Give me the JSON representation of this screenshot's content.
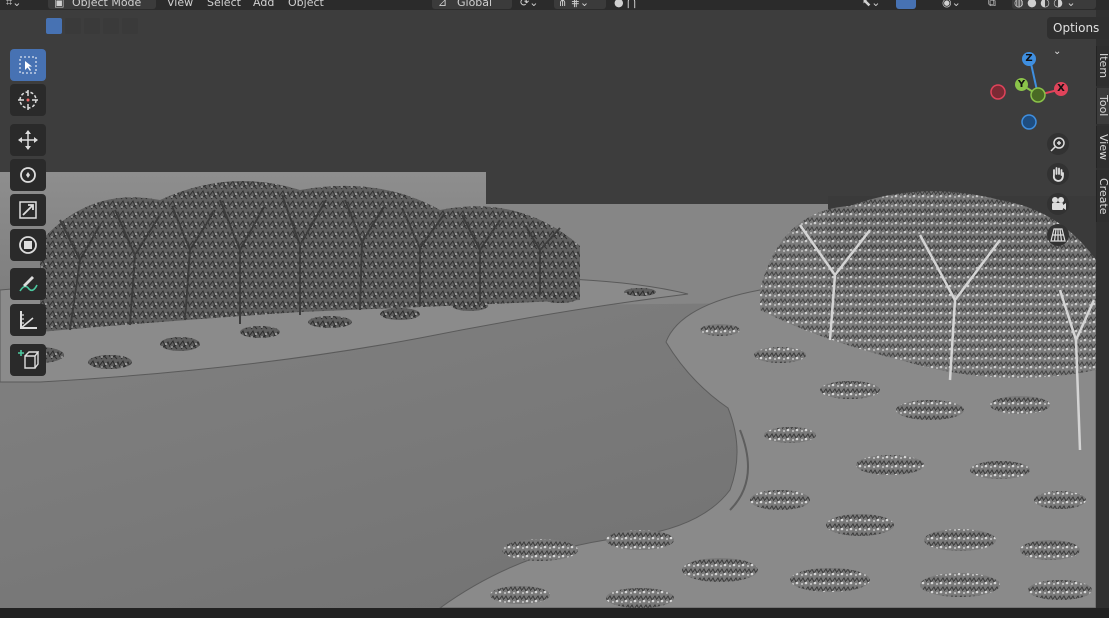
{
  "header": {
    "mode_label": "Object Mode",
    "menus": [
      "View",
      "Select",
      "Add",
      "Object"
    ],
    "orientation_label": "Global"
  },
  "select_modes": [
    "select-set-new",
    "select-extend",
    "select-subtract",
    "select-invert",
    "select-intersect"
  ],
  "toolbar": {
    "tools": [
      {
        "name": "select-box-tool",
        "icon": "select-box-icon",
        "active": true
      },
      {
        "name": "cursor-tool",
        "icon": "cursor-icon",
        "active": false
      },
      {
        "name": "move-tool",
        "icon": "move-icon",
        "active": false
      },
      {
        "name": "rotate-tool",
        "icon": "rotate-icon",
        "active": false
      },
      {
        "name": "scale-tool",
        "icon": "scale-icon",
        "active": false
      },
      {
        "name": "transform-tool",
        "icon": "transform-icon",
        "active": false
      },
      {
        "name": "annotate-tool",
        "icon": "annotate-icon",
        "active": false
      },
      {
        "name": "measure-tool",
        "icon": "measure-icon",
        "active": false
      },
      {
        "name": "add-cube-tool",
        "icon": "add-cube-icon",
        "active": false
      }
    ]
  },
  "options_label": "Options",
  "sidebar_tabs": [
    "Item",
    "Tool",
    "View",
    "Create"
  ],
  "active_sidebar_tab": "Tool",
  "gizmo": {
    "z_label": "Z",
    "y_label": "Y",
    "x_label": "X",
    "colors": {
      "x": "#e0435a",
      "y": "#8bc34a",
      "z": "#3f8fe0"
    }
  },
  "nav_buttons": [
    "zoom-icon",
    "hand-pan-icon",
    "camera-icon",
    "perspective-grid-icon"
  ],
  "colors": {
    "accent": "#4772b3",
    "viewport_bg": "#3d3d3d",
    "ground": "#7a7a7a"
  }
}
